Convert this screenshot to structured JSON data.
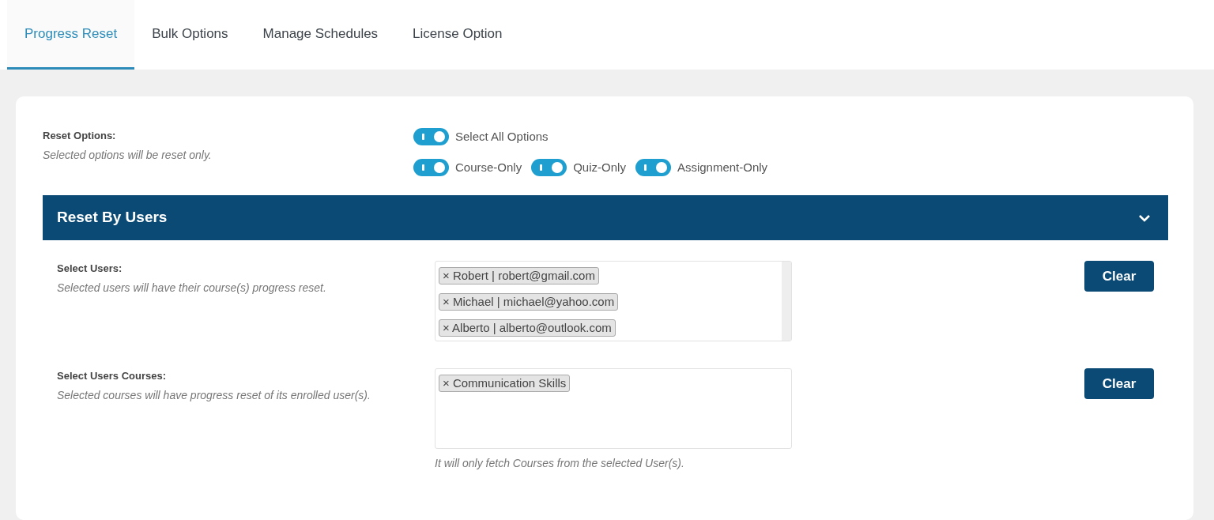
{
  "tabs": [
    {
      "label": "Progress Reset",
      "selected": true
    },
    {
      "label": "Bulk Options",
      "selected": false
    },
    {
      "label": "Manage Schedules",
      "selected": false
    },
    {
      "label": "License Option",
      "selected": false
    }
  ],
  "reset_options": {
    "label": "Reset Options:",
    "hint": "Selected options will be reset only.",
    "select_all": {
      "label": "Select All Options",
      "on": true
    },
    "options": [
      {
        "label": "Course-Only",
        "on": true
      },
      {
        "label": "Quiz-Only",
        "on": true
      },
      {
        "label": "Assignment-Only",
        "on": true
      }
    ]
  },
  "panel": {
    "title": "Reset By Users",
    "expanded": true,
    "fields": [
      {
        "label": "Select Users:",
        "hint": "Selected users will have their course(s) progress reset.",
        "scrollable": true,
        "tags": [
          {
            "remove": "×",
            "text": "Robert | robert@gmail.com"
          },
          {
            "remove": "×",
            "text": "Michael | michael@yahoo.com"
          },
          {
            "remove": "×",
            "text": "Alberto | alberto@outlook.com"
          }
        ],
        "button": "Clear"
      },
      {
        "label": "Select Users Courses:",
        "hint": "Selected courses will have progress reset of its enrolled user(s).",
        "scrollable": false,
        "tags": [
          {
            "remove": "×",
            "text": "Communication Skills"
          }
        ],
        "button": "Clear",
        "note": "It will only fetch Courses from the selected User(s)."
      }
    ]
  }
}
